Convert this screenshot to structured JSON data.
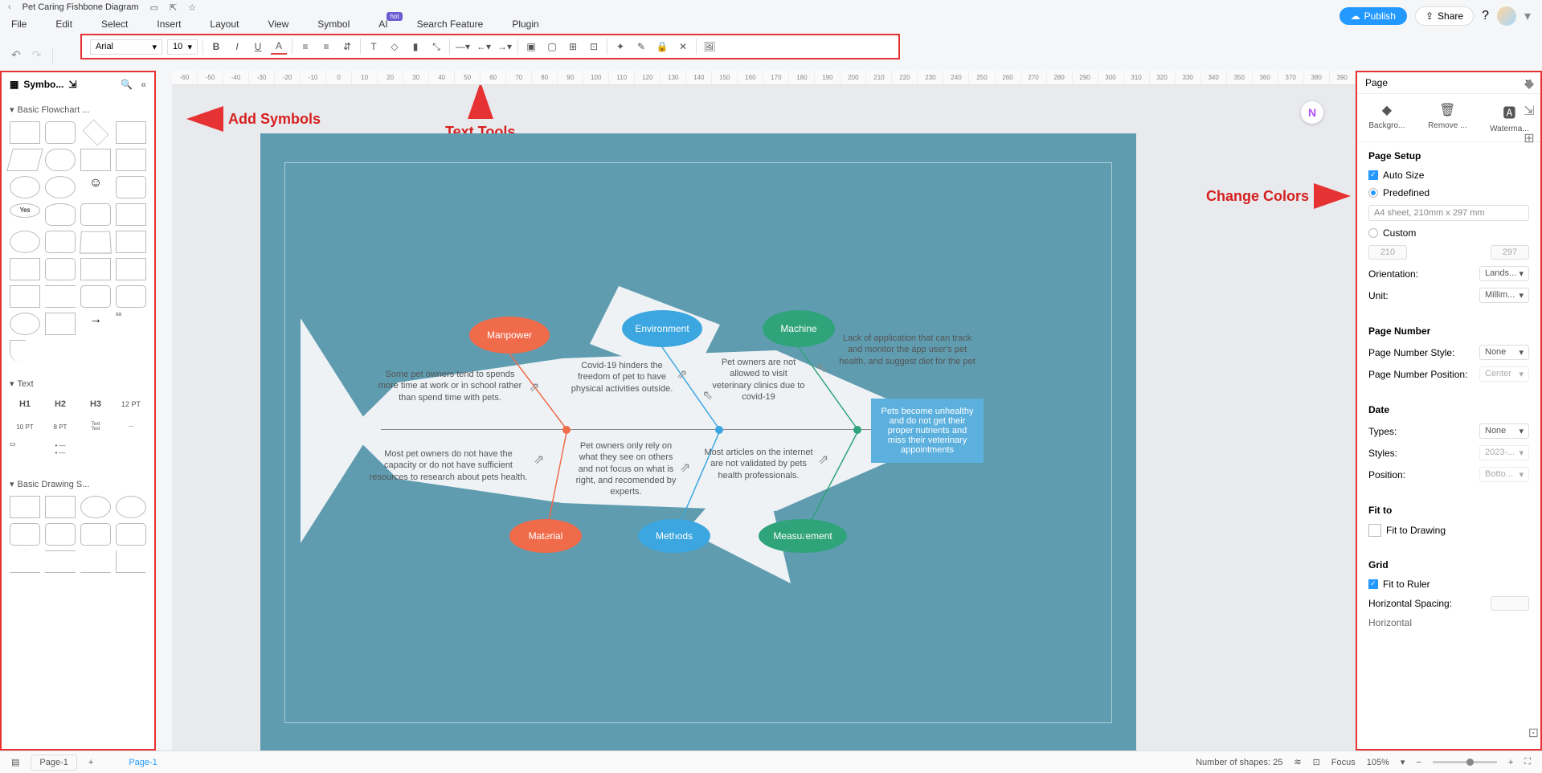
{
  "header": {
    "title": "Pet Caring Fishbone Diagram",
    "publish": "Publish",
    "share": "Share"
  },
  "menu": [
    "File",
    "Edit",
    "Select",
    "Insert",
    "Layout",
    "View",
    "Symbol",
    "AI",
    "Search Feature",
    "Plugin"
  ],
  "toolbar": {
    "font": "Arial",
    "size": "10"
  },
  "left": {
    "title": "Symbo...",
    "sec1": "Basic Flowchart ...",
    "sec2": "Text",
    "sec3": "Basic Drawing S...",
    "text_items": [
      "H1",
      "H2",
      "H3",
      "12 PT",
      "10 PT",
      "8 PT"
    ]
  },
  "annotations": {
    "add_symbols": "Add Symbols",
    "text_tools": "Text Tools",
    "change_colors": "Change Colors"
  },
  "diagram": {
    "causes_top": {
      "manpower": "Manpower",
      "environment": "Environment",
      "machine": "Machine"
    },
    "causes_bot": {
      "material": "Material",
      "methods": "Methods",
      "measurement": "Measurement"
    },
    "text": {
      "manpower1": "Some pet owners tend to spends more time at work or in school rather than spend time with pets.",
      "manpower2": "Most pet owners do not have the capacity or do not have sufficient resources to research about pets health.",
      "environment1": "Covid-19 hinders the freedom of pet to have physical activities outside.",
      "environment2": "Pet owners only rely on what they see on others and not focus on what is right, and recomended by experts.",
      "machine1": "Pet owners are not allowed to visit veterinary clinics due to covid-19",
      "machine2": "Most articles on the internet are not validated by pets health professionals.",
      "machine3": "Lack of application that can track and monitor the app user's pet health, and suggest diet for the pet",
      "result": "Pets become unhealthy and do not get their proper nutrients and miss their veterinary appointments"
    }
  },
  "right": {
    "title": "Page",
    "tabs": [
      "Backgro...",
      "Remove ...",
      "Waterma..."
    ],
    "page_setup": "Page Setup",
    "auto_size": "Auto Size",
    "predefined": "Predefined",
    "a4": "A4 sheet, 210mm x 297 mm",
    "custom": "Custom",
    "w": "210",
    "h": "297",
    "orientation": "Orientation:",
    "orientation_v": "Lands...",
    "unit": "Unit:",
    "unit_v": "Millim...",
    "page_number": "Page Number",
    "pn_style": "Page Number Style:",
    "pn_style_v": "None",
    "pn_pos": "Page Number Position:",
    "pn_pos_v": "Center",
    "date": "Date",
    "types": "Types:",
    "types_v": "None",
    "styles": "Styles:",
    "styles_v": "2023-...",
    "position": "Position:",
    "position_v": "Botto...",
    "fit_to": "Fit to",
    "fit_drawing": "Fit to Drawing",
    "grid": "Grid",
    "fit_ruler": "Fit to Ruler",
    "h_spacing": "Horizontal Spacing:",
    "horizontal": "Horizontal"
  },
  "status": {
    "page": "Page-1",
    "tab": "Page-1",
    "shapes": "Number of shapes: 25",
    "focus": "Focus",
    "zoom": "105%"
  },
  "ruler": [
    "-60",
    "-50",
    "-40",
    "-30",
    "-20",
    "-10",
    "0",
    "10",
    "20",
    "30",
    "40",
    "50",
    "60",
    "70",
    "80",
    "90",
    "100",
    "110",
    "120",
    "130",
    "140",
    "150",
    "160",
    "170",
    "180",
    "190",
    "200",
    "210",
    "220",
    "230",
    "240",
    "250",
    "260",
    "270",
    "280",
    "290",
    "300",
    "310",
    "320",
    "330",
    "340",
    "350",
    "360",
    "370",
    "380",
    "390"
  ]
}
